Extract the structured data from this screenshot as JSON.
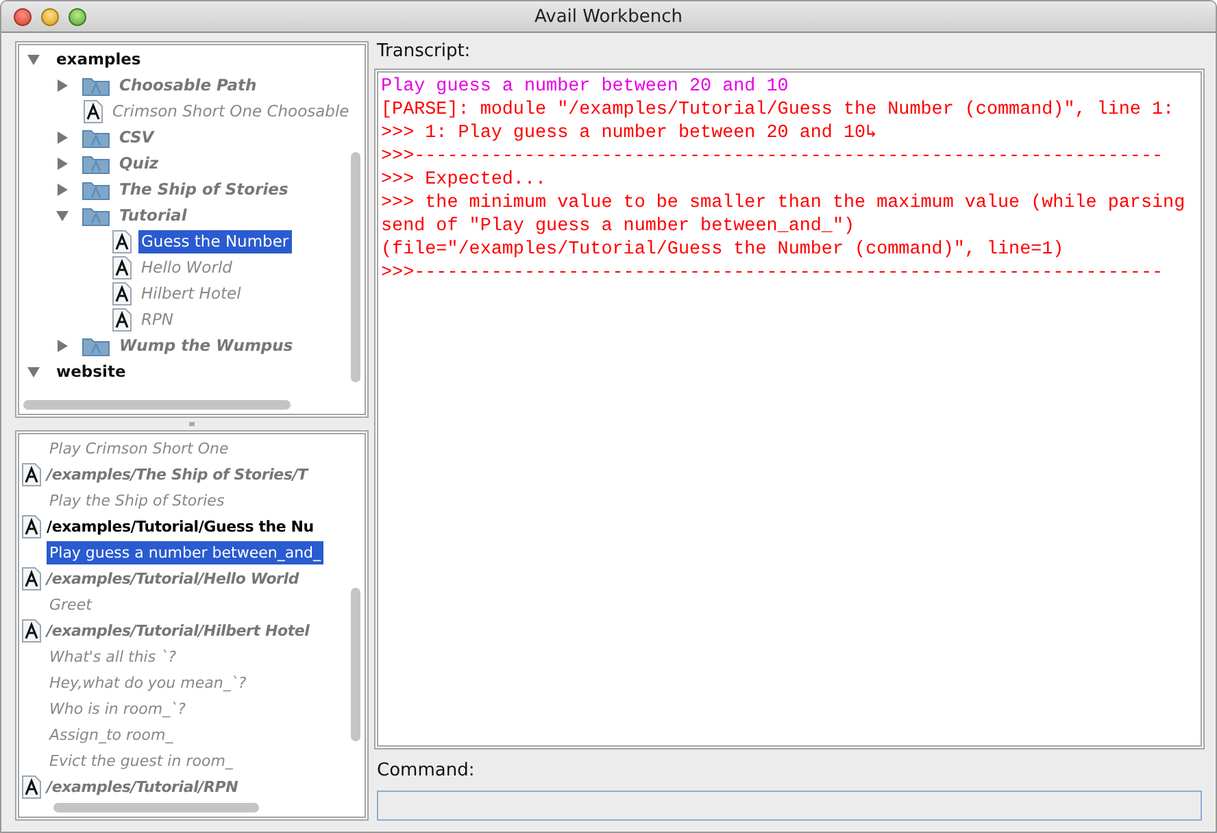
{
  "window": {
    "title": "Avail Workbench"
  },
  "module_tree": [
    {
      "kind": "root",
      "label": "examples",
      "expanded": true,
      "selected": false,
      "children": [
        {
          "kind": "package",
          "label": "Choosable Path",
          "expanded": false,
          "selected": false
        },
        {
          "kind": "module",
          "label": "Crimson Short One Choosable",
          "selected": false
        },
        {
          "kind": "package",
          "label": "CSV",
          "expanded": false,
          "selected": false
        },
        {
          "kind": "package",
          "label": "Quiz",
          "expanded": false,
          "selected": false
        },
        {
          "kind": "package",
          "label": "The Ship of Stories",
          "expanded": false,
          "selected": false
        },
        {
          "kind": "package",
          "label": "Tutorial",
          "expanded": true,
          "selected": false,
          "children": [
            {
              "kind": "module",
              "label": "Guess the Number",
              "selected": true
            },
            {
              "kind": "module",
              "label": "Hello World",
              "selected": false
            },
            {
              "kind": "module",
              "label": "Hilbert Hotel",
              "selected": false
            },
            {
              "kind": "module",
              "label": "RPN",
              "selected": false
            }
          ]
        },
        {
          "kind": "package",
          "label": "Wump the Wumpus",
          "expanded": false,
          "selected": false
        }
      ]
    },
    {
      "kind": "root",
      "label": "website",
      "expanded": true,
      "selected": false
    }
  ],
  "entry_points": [
    {
      "kind": "entry",
      "label": "Play Crimson Short One",
      "selected": false
    },
    {
      "kind": "module",
      "label": "/examples/The Ship of Stories/T",
      "loaded": false,
      "selected": false
    },
    {
      "kind": "entry",
      "label": "Play the Ship of Stories",
      "selected": false
    },
    {
      "kind": "module",
      "label": "/examples/Tutorial/Guess the Nu",
      "loaded": true,
      "selected": false
    },
    {
      "kind": "entry",
      "label": "Play guess a number between_and_",
      "selected": true
    },
    {
      "kind": "module",
      "label": "/examples/Tutorial/Hello World",
      "loaded": false,
      "selected": false
    },
    {
      "kind": "entry",
      "label": "Greet",
      "selected": false
    },
    {
      "kind": "module",
      "label": "/examples/Tutorial/Hilbert Hotel",
      "loaded": false,
      "selected": false
    },
    {
      "kind": "entry",
      "label": "What's all this `?",
      "selected": false
    },
    {
      "kind": "entry",
      "label": "Hey,what do you mean_`?",
      "selected": false
    },
    {
      "kind": "entry",
      "label": "Who is in room_`?",
      "selected": false
    },
    {
      "kind": "entry",
      "label": "Assign_to room_",
      "selected": false
    },
    {
      "kind": "entry",
      "label": "Evict the guest in room_",
      "selected": false
    },
    {
      "kind": "module",
      "label": "/examples/Tutorial/RPN",
      "loaded": false,
      "selected": false
    }
  ],
  "transcript": {
    "label": "Transcript:",
    "lines": [
      {
        "kind": "command",
        "text": "Play guess a number between 20 and 10"
      },
      {
        "kind": "error",
        "text": "[PARSE]: module \"/examples/Tutorial/Guess the Number (command)\", line 1:"
      },
      {
        "kind": "error",
        "text": ">>> 1: Play guess a number between 20 and 10↳"
      },
      {
        "kind": "error",
        "text": ">>>--------------------------------------------------------------------"
      },
      {
        "kind": "error",
        "text": ">>> Expected..."
      },
      {
        "kind": "error",
        "text": ">>> the minimum value to be smaller than the maximum value (while parsing"
      },
      {
        "kind": "error",
        "text": "send of \"Play guess a number between_and_\")"
      },
      {
        "kind": "error",
        "text": "(file=\"/examples/Tutorial/Guess the Number (command)\", line=1)"
      },
      {
        "kind": "error",
        "text": ">>>--------------------------------------------------------------------"
      }
    ]
  },
  "command": {
    "label": "Command:"
  }
}
